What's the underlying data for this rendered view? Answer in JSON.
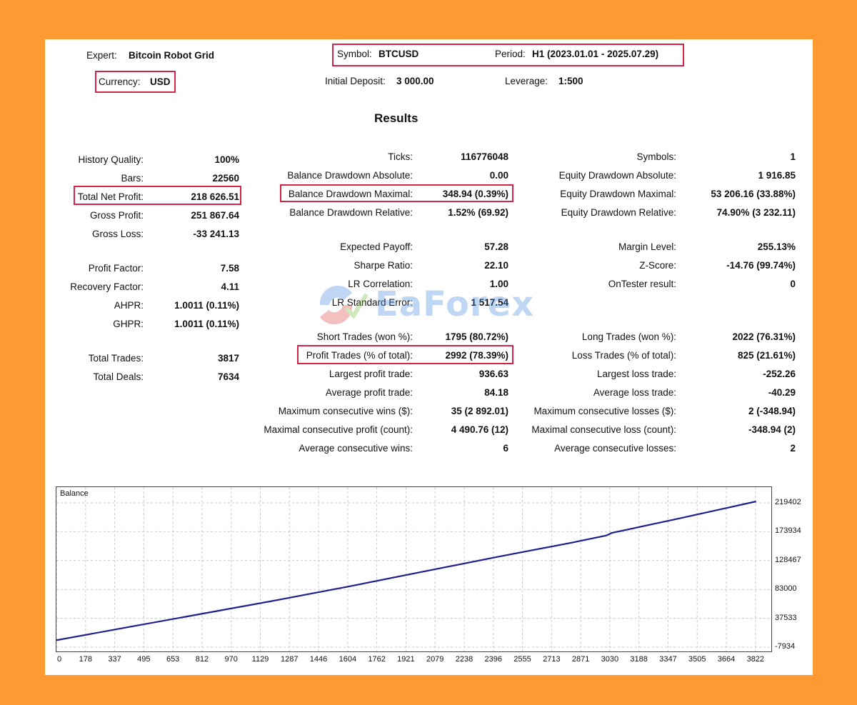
{
  "header": {
    "expert_label": "Expert:",
    "expert_value": "Bitcoin Robot Grid",
    "symbol_label": "Symbol:",
    "symbol_value": "BTCUSD",
    "period_label": "Period:",
    "period_value": "H1 (2023.01.01 - 2025.07.29)",
    "currency_label": "Currency:",
    "currency_value": "USD",
    "deposit_label": "Initial Deposit:",
    "deposit_value": "3 000.00",
    "leverage_label": "Leverage:",
    "leverage_value": "1:500"
  },
  "results_title": "Results",
  "col1": [
    {
      "label": "History Quality:",
      "value": "100%"
    },
    {
      "label": "Bars:",
      "value": "22560"
    },
    {
      "label": "Total Net Profit:",
      "value": "218 626.51"
    },
    {
      "label": "Gross Profit:",
      "value": "251 867.64"
    },
    {
      "label": "Gross Loss:",
      "value": "-33 241.13"
    },
    {
      "label": "Profit Factor:",
      "value": "7.58"
    },
    {
      "label": "Recovery Factor:",
      "value": "4.11"
    },
    {
      "label": "AHPR:",
      "value": "1.0011 (0.11%)"
    },
    {
      "label": "GHPR:",
      "value": "1.0011 (0.11%)"
    },
    {
      "label": "Total Trades:",
      "value": "3817"
    },
    {
      "label": "Total Deals:",
      "value": "7634"
    }
  ],
  "col2": [
    {
      "label": "Ticks:",
      "value": "116776048"
    },
    {
      "label": "Balance Drawdown Absolute:",
      "value": "0.00"
    },
    {
      "label": "Balance Drawdown Maximal:",
      "value": "348.94 (0.39%)"
    },
    {
      "label": "Balance Drawdown Relative:",
      "value": "1.52% (69.92)"
    },
    {
      "label": "Expected Payoff:",
      "value": "57.28"
    },
    {
      "label": "Sharpe Ratio:",
      "value": "22.10"
    },
    {
      "label": "LR Correlation:",
      "value": "1.00"
    },
    {
      "label": "LR Standard Error:",
      "value": "1 517.54"
    },
    {
      "label": "Short Trades (won %):",
      "value": "1795 (80.72%)"
    },
    {
      "label": "Profit Trades (% of total):",
      "value": "2992 (78.39%)"
    },
    {
      "label": "Largest profit trade:",
      "value": "936.63"
    },
    {
      "label": "Average profit trade:",
      "value": "84.18"
    },
    {
      "label": "Maximum consecutive wins ($):",
      "value": "35 (2 892.01)"
    },
    {
      "label": "Maximal consecutive profit (count):",
      "value": "4 490.76 (12)"
    },
    {
      "label": "Average consecutive wins:",
      "value": "6"
    }
  ],
  "col3": [
    {
      "label": "Symbols:",
      "value": "1"
    },
    {
      "label": "Equity Drawdown Absolute:",
      "value": "1 916.85"
    },
    {
      "label": "Equity Drawdown Maximal:",
      "value": "53 206.16 (33.88%)"
    },
    {
      "label": "Equity Drawdown Relative:",
      "value": "74.90% (3 232.11)"
    },
    {
      "label": "Margin Level:",
      "value": "255.13%"
    },
    {
      "label": "Z-Score:",
      "value": "-14.76 (99.74%)"
    },
    {
      "label": "OnTester result:",
      "value": "0"
    },
    {
      "label": "Long Trades (won %):",
      "value": "2022 (76.31%)"
    },
    {
      "label": "Loss Trades (% of total):",
      "value": "825 (21.61%)"
    },
    {
      "label": "Largest loss trade:",
      "value": "-252.26"
    },
    {
      "label": "Average loss trade:",
      "value": "-40.29"
    },
    {
      "label": "Maximum consecutive losses ($):",
      "value": "2 (-348.94)"
    },
    {
      "label": "Maximal consecutive loss (count):",
      "value": "-348.94 (2)"
    },
    {
      "label": "Average consecutive losses:",
      "value": "2"
    }
  ],
  "watermark": "EaForex",
  "colors": {
    "background": "#FF9A33",
    "highlight": "#D6234A",
    "line": "#1F1F8F",
    "grid": "#C8C8C8"
  },
  "chart_data": {
    "type": "line",
    "title": "Balance",
    "xlabel": "",
    "ylabel": "",
    "x_ticks": [
      "0",
      "178",
      "337",
      "495",
      "653",
      "812",
      "970",
      "1129",
      "1287",
      "1446",
      "1604",
      "1762",
      "1921",
      "2079",
      "2238",
      "2396",
      "2555",
      "2713",
      "2871",
      "3030",
      "3188",
      "3347",
      "3505",
      "3664",
      "3822"
    ],
    "y_ticks": [
      "219402",
      "173934",
      "128467",
      "83000",
      "37533",
      "-7934"
    ],
    "xlim": [
      0,
      3900
    ],
    "ylim": [
      -7934,
      219402
    ],
    "grid": true,
    "series": [
      {
        "name": "Balance",
        "x": [
          0,
          400,
          800,
          1200,
          1600,
          2000,
          2400,
          2800,
          3000,
          3030,
          3400,
          3817
        ],
        "y": [
          3000,
          24000,
          45000,
          66000,
          88000,
          111000,
          134000,
          156000,
          168000,
          172000,
          195000,
          221626
        ]
      }
    ]
  }
}
